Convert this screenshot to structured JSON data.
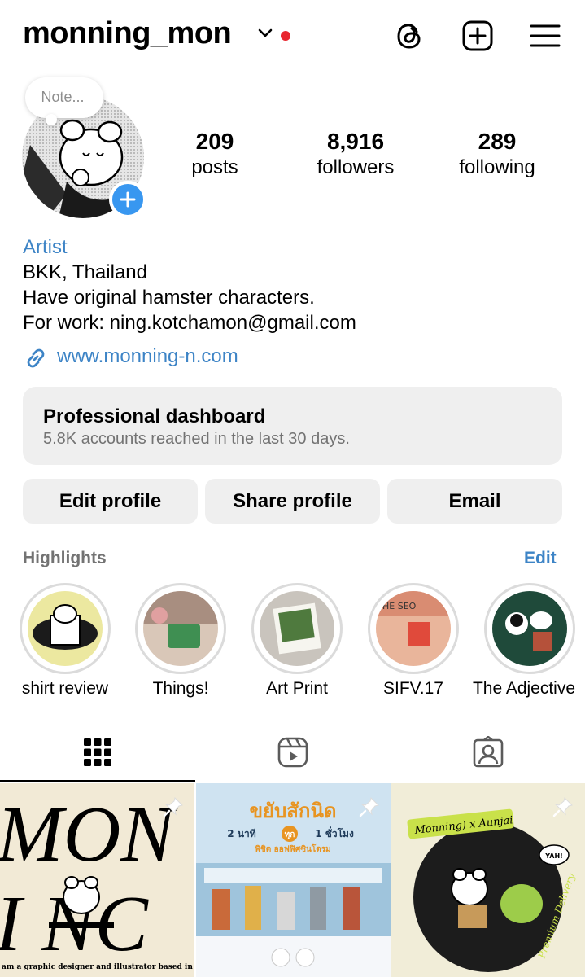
{
  "header": {
    "username": "monning_mon",
    "icons": [
      "chevron-down-icon",
      "threads-icon",
      "new-post-icon",
      "menu-icon"
    ],
    "notification_color": "#e8262f"
  },
  "note": {
    "placeholder": "Note..."
  },
  "stats": [
    {
      "value": "209",
      "label": "posts"
    },
    {
      "value": "8,916",
      "label": "followers"
    },
    {
      "value": "289",
      "label": "following"
    }
  ],
  "bio": {
    "category": "Artist",
    "lines": [
      "BKK, Thailand",
      "Have original hamster characters.",
      "For work: ning.kotchamon@gmail.com"
    ],
    "link": "www.monning-n.com"
  },
  "dashboard": {
    "title": "Professional dashboard",
    "subtitle": "5.8K accounts reached in the last 30 days."
  },
  "buttons": [
    "Edit profile",
    "Share profile",
    "Email"
  ],
  "highlights": {
    "title": "Highlights",
    "edit": "Edit",
    "items": [
      {
        "label": "shirt review"
      },
      {
        "label": "Things!"
      },
      {
        "label": "Art Print"
      },
      {
        "label": "SIFV.17"
      },
      {
        "label": "The Adjective"
      }
    ]
  },
  "tabs": [
    "grid-icon",
    "reels-icon",
    "tagged-icon"
  ],
  "posts": [
    {
      "text_top": "MON",
      "text_bottom": "I NC",
      "caption": "am a graphic designer and illustrator based in Thailand"
    },
    {
      "title": "ขยับสักนิด",
      "subtitle_a": "2 นาที",
      "subtitle_badge": "ทุก",
      "subtitle_b": "1 ชั่วโมง",
      "subtitle2": "พิชิต ออฟฟิศซินโดรม"
    },
    {
      "title": "Monning) x Aunjai",
      "bubble": "YAH!",
      "script": "Premium Delivery"
    }
  ],
  "colors": {
    "accent": "#3d84c6",
    "badge_blue": "#3897f0",
    "button_bg": "#efefef",
    "muted_text": "#737373"
  }
}
